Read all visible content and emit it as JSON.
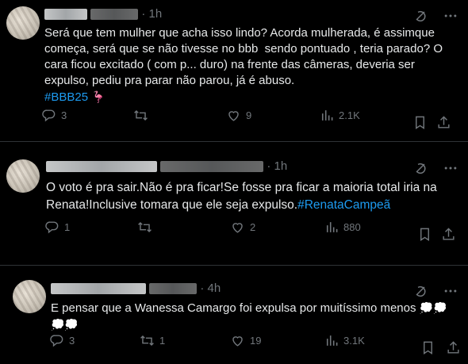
{
  "tweets": [
    {
      "time": "1h",
      "text": "Será que tem mulher que acha isso lindo? Acorda mulherada, é assimque começa, será que se não tivesse no bbb  sendo pontuado , teria parado? O cara ficou excitado ( com p... duro) na frente das câmeras, deveria ser expulso, pediu pra parar não parou, já é abuso.",
      "hashtag": "#BBB25",
      "emoji": "🦩",
      "replies": "3",
      "retweets": "",
      "likes": "9",
      "views": "2.1K"
    },
    {
      "time": "1h",
      "text": "O voto é pra sair.Não é pra ficar!Se fosse pra ficar a maioria total iria na Renata!Inclusive tomara que ele seja expulso.",
      "hashtag": "#RenataCampeã",
      "replies": "1",
      "retweets": "",
      "likes": "2",
      "views": "880"
    },
    {
      "time": "4h",
      "text": "E pensar que a Wanessa Camargo foi expulsa por muitíssimo menos",
      "emoji": "💭💭",
      "emoji2": "💭💭",
      "replies": "3",
      "retweets": "1",
      "likes": "19",
      "views": "3.1K"
    }
  ],
  "icons": {
    "grok": "grok-icon",
    "more": "more-icon",
    "reply": "reply-icon",
    "retweet": "retweet-icon",
    "like": "like-icon",
    "views": "views-icon",
    "bookmark": "bookmark-icon",
    "share": "share-icon"
  }
}
